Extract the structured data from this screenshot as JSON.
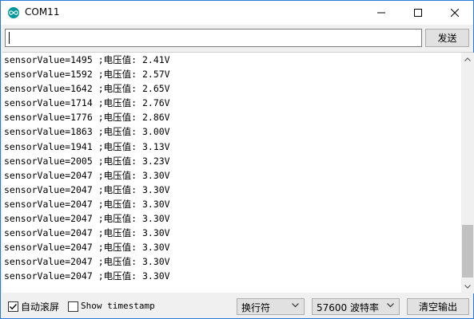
{
  "window": {
    "title": "COM11",
    "icon": "arduino-icon",
    "controls": [
      "minimize-icon",
      "maximize-icon",
      "close-icon"
    ]
  },
  "send": {
    "input_value": "",
    "button_label": "发送"
  },
  "output": {
    "lines": [
      "sensorValue=1495 ;电压值: 2.41V",
      "sensorValue=1592 ;电压值: 2.57V",
      "sensorValue=1642 ;电压值: 2.65V",
      "sensorValue=1714 ;电压值: 2.76V",
      "sensorValue=1776 ;电压值: 2.86V",
      "sensorValue=1863 ;电压值: 3.00V",
      "sensorValue=1941 ;电压值: 3.13V",
      "sensorValue=2005 ;电压值: 3.23V",
      "sensorValue=2047 ;电压值: 3.30V",
      "sensorValue=2047 ;电压值: 3.30V",
      "sensorValue=2047 ;电压值: 3.30V",
      "sensorValue=2047 ;电压值: 3.30V",
      "sensorValue=2047 ;电压值: 3.30V",
      "sensorValue=2047 ;电压值: 3.30V",
      "sensorValue=2047 ;电压值: 3.30V",
      "sensorValue=2047 ;电压值: 3.30V"
    ]
  },
  "bottom": {
    "autoscroll_label": "自动滚屏",
    "autoscroll_checked": true,
    "timestamp_label": "Show timestamp",
    "timestamp_checked": false,
    "line_ending_value": "换行符",
    "baud_value": "57600 波特率",
    "clear_label": "清空输出"
  }
}
